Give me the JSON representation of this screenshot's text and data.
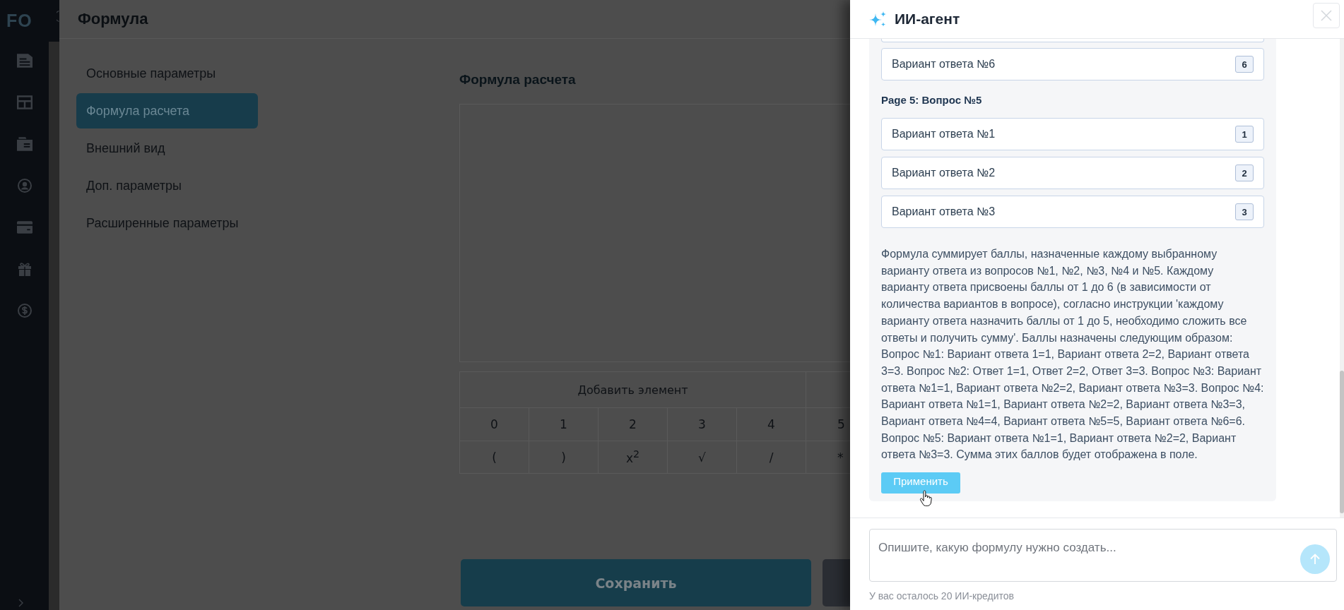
{
  "sidebar": {
    "logo": "FO"
  },
  "header": {
    "title": "Формула"
  },
  "settings_nav": [
    {
      "label": "Основные параметры",
      "selected": false
    },
    {
      "label": "Формула расчета",
      "selected": true
    },
    {
      "label": "Внешний вид",
      "selected": false
    },
    {
      "label": "Доп. параметры",
      "selected": false
    },
    {
      "label": "Расширенные параметры",
      "selected": false
    }
  ],
  "formula": {
    "title": "Формула расчета",
    "keypad": {
      "header": "Добавить элемент",
      "rows": [
        [
          "0",
          "1",
          "2",
          "3",
          "4",
          "5"
        ],
        [
          "(",
          ")",
          "x$^{2}$",
          "√",
          "/",
          "*"
        ]
      ]
    }
  },
  "actions": {
    "save": "Сохранить"
  },
  "ai_panel": {
    "title": "ИИ-агент",
    "message": {
      "blocks": [
        {
          "kind": "option",
          "label": "Вариант ответа №6",
          "score": "6"
        },
        {
          "kind": "heading",
          "text": "Page 5: Вопрос №5"
        },
        {
          "kind": "option",
          "label": "Вариант ответа №1",
          "score": "1"
        },
        {
          "kind": "option",
          "label": "Вариант ответа №2",
          "score": "2"
        },
        {
          "kind": "option",
          "label": "Вариант ответа №3",
          "score": "3"
        }
      ],
      "summary": "Формула суммирует баллы, назначенные каждому выбранному варианту ответа из вопросов №1, №2, №3, №4 и №5. Каждому варианту ответа присвоены баллы от 1 до 6 (в зависимости от количества вариантов в вопросе), согласно инструкции 'каждому варианту ответа назначить баллы от 1 до 5, необходимо сложить все ответы и получить сумму'. Баллы назначены следующим образом: Вопрос №1: Вариант ответа 1=1, Вариант ответа 2=2, Вариант ответа 3=3. Вопрос №2: Ответ 1=1, Ответ 2=2, Ответ 3=3. Вопрос №3: Вариант ответа №1=1, Вариант ответа №2=2, Вариант ответа №3=3. Вопрос №4: Вариант ответа №1=1, Вариант ответа №2=2, Вариант ответа №3=3, Вариант ответа №4=4, Вариант ответа №5=5, Вариант ответа №6=6. Вопрос №5: Вариант ответа №1=1, Вариант ответа №2=2, Вариант ответа №3=3. Сумма этих баллов будет отображена в поле.",
      "apply_button": "Применить"
    },
    "input": {
      "placeholder": "Опишите, какую формулу нужно создать..."
    },
    "credits": "У вас осталось 20 ИИ-кредитов"
  }
}
